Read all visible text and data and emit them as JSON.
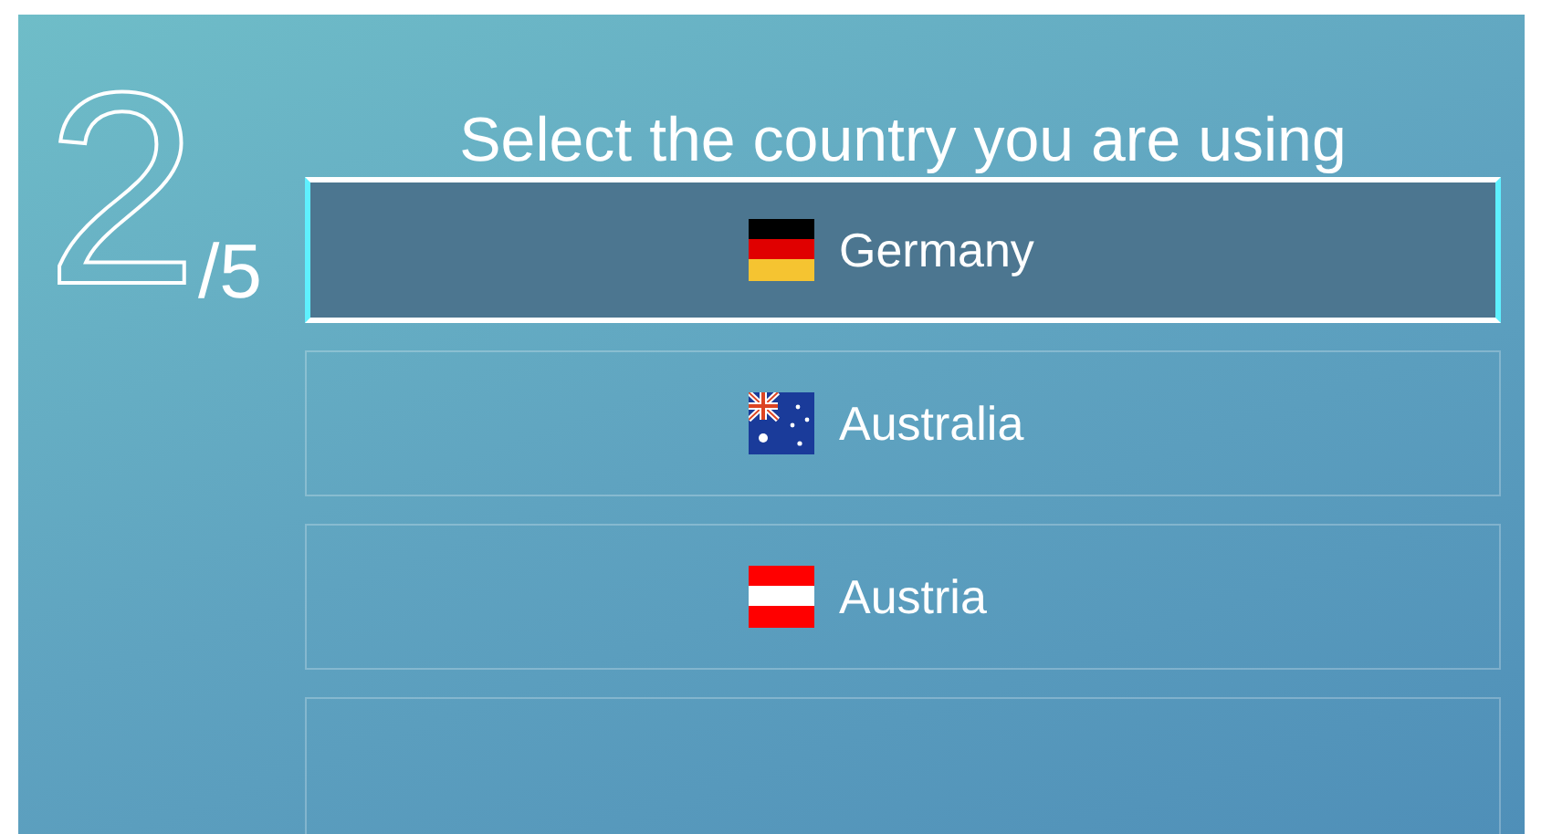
{
  "step": {
    "current": "2",
    "total": "/5"
  },
  "title": "Select the country you are using",
  "options": [
    {
      "label": "Germany",
      "kind": "de",
      "selected": true
    },
    {
      "label": "Australia",
      "kind": "au",
      "selected": false
    },
    {
      "label": "Austria",
      "kind": "at",
      "selected": false
    }
  ]
}
